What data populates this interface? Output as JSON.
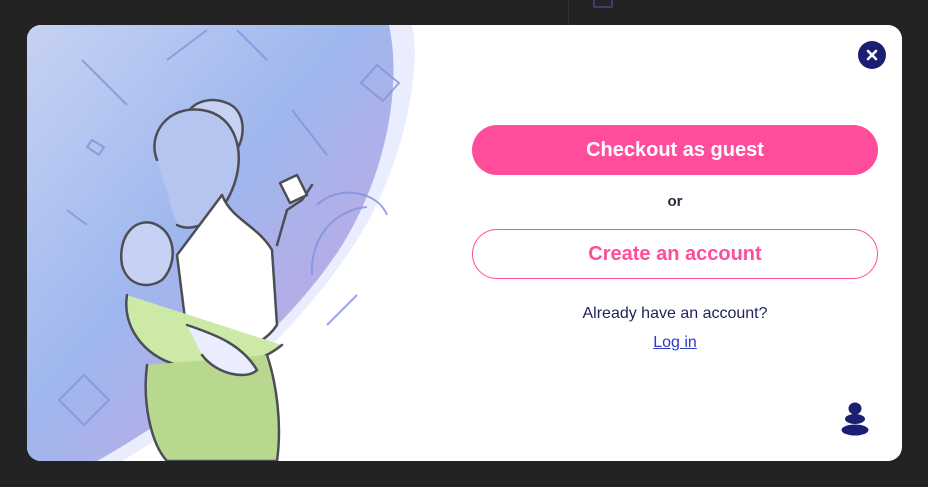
{
  "modal": {
    "primary_button_label": "Checkout as guest",
    "separator_text": "or",
    "secondary_button_label": "Create an account",
    "prompt_text": "Already have an account?",
    "login_link_label": "Log in"
  },
  "icons": {
    "close": "close-icon",
    "brand": "brand-logo-icon",
    "illustration": "mother-and-child-with-phone-illustration"
  },
  "colors": {
    "accent_pink": "#ff4c9b",
    "navy": "#1a1f71",
    "link_blue": "#2e3bc9",
    "backdrop": "#232323"
  }
}
